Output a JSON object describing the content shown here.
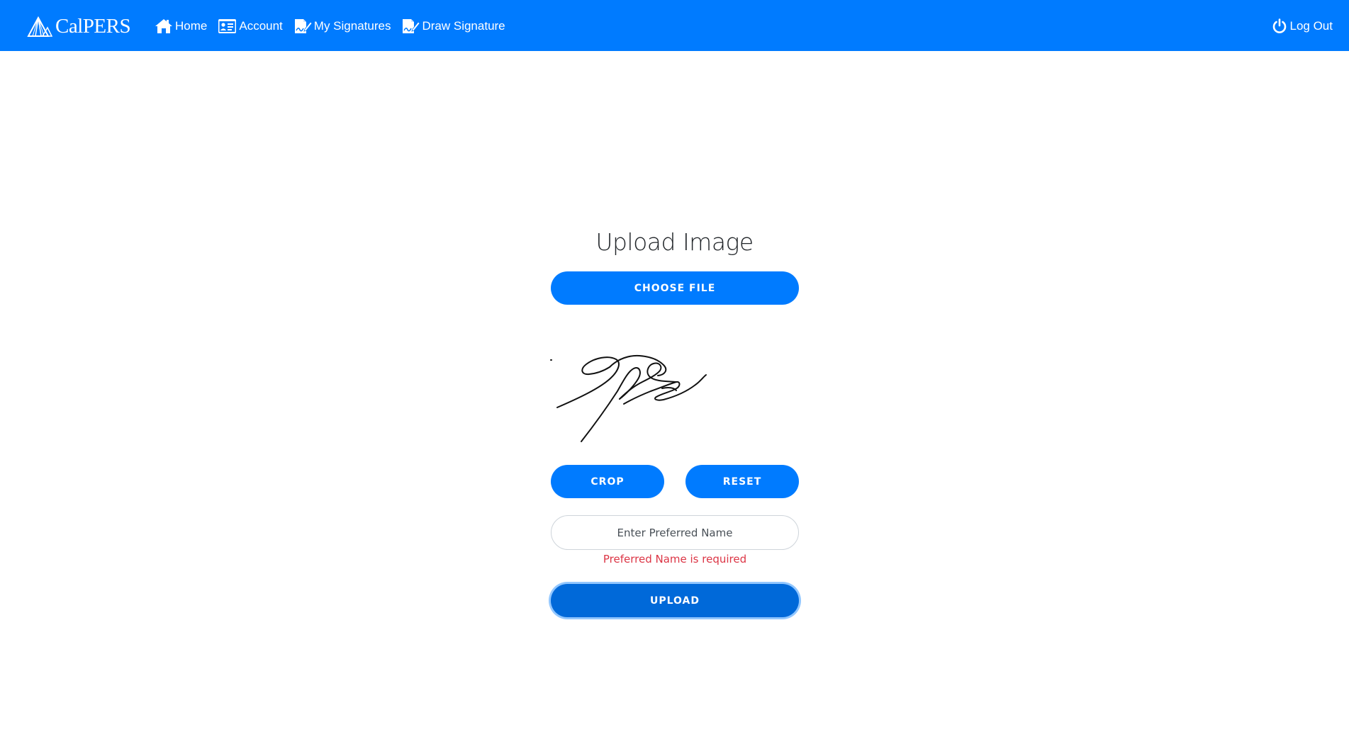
{
  "brand": {
    "name": "CalPERS",
    "logo_icon": "calpers-logo-icon"
  },
  "nav": {
    "items": [
      {
        "label": "Home",
        "icon": "home-icon"
      },
      {
        "label": "Account",
        "icon": "id-card-icon"
      },
      {
        "label": "My Signatures",
        "icon": "signature-doc-icon"
      },
      {
        "label": "Draw Signature",
        "icon": "draw-signature-icon"
      }
    ],
    "logout": {
      "label": "Log Out",
      "icon": "power-icon"
    }
  },
  "main": {
    "title": "Upload Image",
    "choose_file_label": "CHOOSE FILE",
    "crop_label": "CROP",
    "reset_label": "RESET",
    "name_input": {
      "placeholder": "Enter Preferred Name",
      "value": ""
    },
    "error_text": "Preferred Name is required",
    "upload_label": "UPLOAD"
  },
  "colors": {
    "primary": "#007bff",
    "primary_active": "#0069d9",
    "error": "#dc3545"
  }
}
